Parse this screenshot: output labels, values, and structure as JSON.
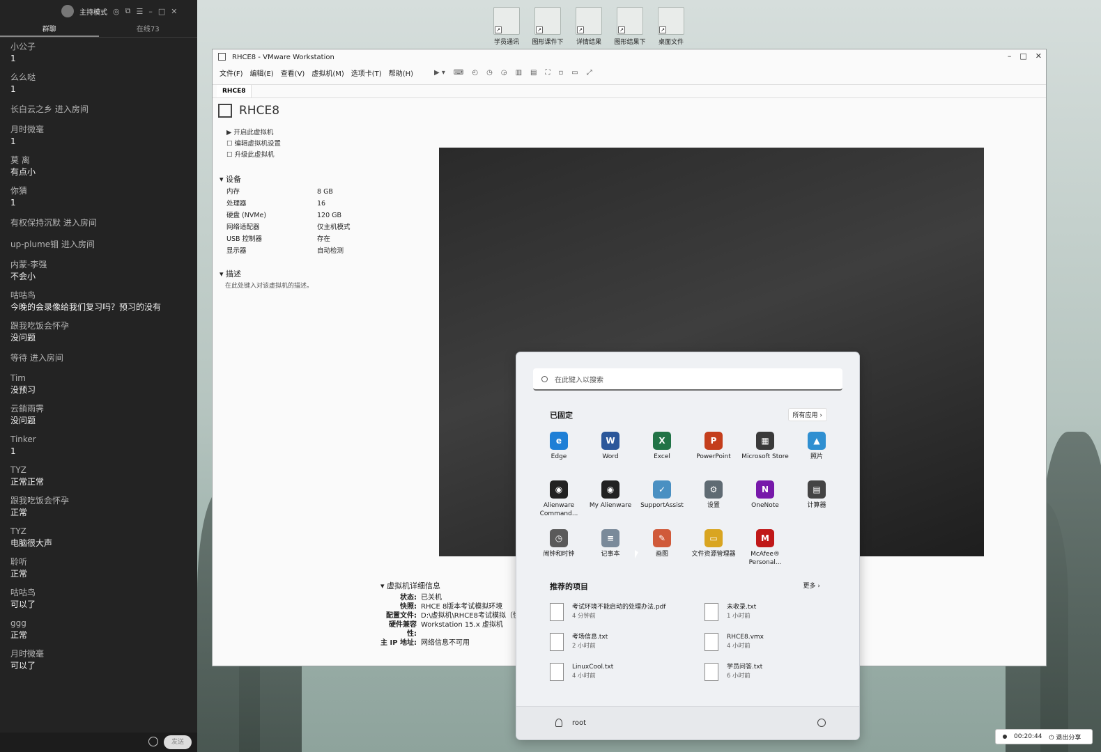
{
  "desktop": {
    "icons": [
      "学员通讯",
      "图形课件下",
      "详情结果",
      "图形结果下",
      "桌面文件"
    ]
  },
  "chat": {
    "header_title": "主持模式",
    "tabs": [
      "群聊",
      "在线73"
    ],
    "messages": [
      {
        "name": "小公子",
        "text": "1"
      },
      {
        "name": "么么哒",
        "text": "1"
      },
      {
        "join": "长白云之乡 进入房间"
      },
      {
        "name": "月时微毫",
        "text": "1"
      },
      {
        "name": "莫 离",
        "text": "有点小"
      },
      {
        "name": "你猜",
        "text": "1"
      },
      {
        "join": "有权保持沉默 进入房间"
      },
      {
        "join": "up-plume钼 进入房间"
      },
      {
        "name": "内蒙-李强",
        "text": "不会小"
      },
      {
        "name": "咕咕鸟",
        "text": "今晚的会录像给我们复习吗？预习的没有"
      },
      {
        "name": "跟我吃饭会怀孕",
        "text": "没问题"
      },
      {
        "join": "等待 进入房间"
      },
      {
        "name": "Tim",
        "text": "没预习"
      },
      {
        "name": "云銷雨霁",
        "text": "没问题"
      },
      {
        "name": "Tinker",
        "text": "1"
      },
      {
        "name": "TYZ",
        "text": "正常正常"
      },
      {
        "name": "跟我吃饭会怀孕",
        "text": "正常"
      },
      {
        "name": "TYZ",
        "text": "电脑很大声"
      },
      {
        "name": "聆听",
        "text": "正常"
      },
      {
        "name": "咕咕鸟",
        "text": "可以了"
      },
      {
        "name": "ggg",
        "text": "正常"
      },
      {
        "name": "月时微毫",
        "text": "可以了"
      }
    ],
    "send_label": "发送"
  },
  "vmware": {
    "title": "RHCE8 - VMware Workstation",
    "menu": [
      "文件(F)",
      "编辑(E)",
      "查看(V)",
      "虚拟机(M)",
      "选项卡(T)",
      "帮助(H)"
    ],
    "tab": "RHCE8",
    "vm_name": "RHCE8",
    "actions": [
      "开启此虚拟机",
      "编辑虚拟机设置",
      "升级此虚拟机"
    ],
    "devices_header": "设备",
    "devices": [
      {
        "name": "内存",
        "value": "8 GB"
      },
      {
        "name": "处理器",
        "value": "16"
      },
      {
        "name": "硬盘 (NVMe)",
        "value": "120 GB"
      },
      {
        "name": "网络适配器",
        "value": "仅主机模式"
      },
      {
        "name": "USB 控制器",
        "value": "存在"
      },
      {
        "name": "显示器",
        "value": "自动检测"
      }
    ],
    "desc_header": "描述",
    "desc_hint": "在此处键入对该虚拟机的描述。",
    "details_header": "虚拟机详细信息",
    "details": [
      {
        "k": "状态:",
        "v": "已关机"
      },
      {
        "k": "快照:",
        "v": "RHCE 8版本考试模拟环境"
      },
      {
        "k": "配置文件:",
        "v": "D:\\虚拟机\\RHCE8考试模拟（快"
      },
      {
        "k": "硬件兼容性:",
        "v": "Workstation 15.x 虚拟机"
      },
      {
        "k": "主 IP 地址:",
        "v": "网络信息不可用"
      }
    ]
  },
  "start_menu": {
    "search_placeholder": "在此键入以搜索",
    "pinned_header": "已固定",
    "all_apps": "所有应用 ›",
    "apps": [
      {
        "label": "Edge",
        "icon": "edge-icon",
        "color": "#1e7fd6",
        "glyph": "e"
      },
      {
        "label": "Word",
        "icon": "word-icon",
        "color": "#2b579a",
        "glyph": "W"
      },
      {
        "label": "Excel",
        "icon": "excel-icon",
        "color": "#217346",
        "glyph": "X"
      },
      {
        "label": "PowerPoint",
        "icon": "powerpoint-icon",
        "color": "#c43e1c",
        "glyph": "P"
      },
      {
        "label": "Microsoft Store",
        "icon": "store-icon",
        "color": "#3a3a3a",
        "glyph": "▦"
      },
      {
        "label": "照片",
        "icon": "photos-icon",
        "color": "#2f8fd1",
        "glyph": "▲"
      },
      {
        "label": "Alienware Command...",
        "icon": "alienware-icon",
        "color": "#222222",
        "glyph": "◉"
      },
      {
        "label": "My Alienware",
        "icon": "my-alienware-icon",
        "color": "#222222",
        "glyph": "◉"
      },
      {
        "label": "SupportAssist",
        "icon": "supportassist-icon",
        "color": "#4a90c2",
        "glyph": "✓"
      },
      {
        "label": "设置",
        "icon": "settings-icon",
        "color": "#5f6b73",
        "glyph": "⚙"
      },
      {
        "label": "OneNote",
        "icon": "onenote-icon",
        "color": "#7719aa",
        "glyph": "N"
      },
      {
        "label": "计算器",
        "icon": "calculator-icon",
        "color": "#444444",
        "glyph": "▤"
      },
      {
        "label": "闹钟和时钟",
        "icon": "clock-icon",
        "color": "#5a5a5a",
        "glyph": "◷"
      },
      {
        "label": "记事本",
        "icon": "notepad-icon",
        "color": "#7a8a9a",
        "glyph": "≡"
      },
      {
        "label": "画图",
        "icon": "paint-icon",
        "color": "#d05a3a",
        "glyph": "✎"
      },
      {
        "label": "文件资源管理器",
        "icon": "explorer-icon",
        "color": "#d9a521",
        "glyph": "▭"
      },
      {
        "label": "McAfee® Personal...",
        "icon": "mcafee-icon",
        "color": "#c01818",
        "glyph": "M"
      }
    ],
    "recommended_header": "推荐的项目",
    "more": "更多  ›",
    "recommended": [
      {
        "name": "考试环境不能启动的处理办法.pdf",
        "time": "4 分钟前"
      },
      {
        "name": "未收录.txt",
        "time": "1 小时前"
      },
      {
        "name": "考场信息.txt",
        "time": "2 小时前"
      },
      {
        "name": "RHCE8.vmx",
        "time": "4 小时前"
      },
      {
        "name": "LinuxCool.txt",
        "time": "4 小时前"
      },
      {
        "name": "学员问答.txt",
        "time": "6 小时前"
      }
    ],
    "user": "root"
  },
  "sharebar": {
    "time": "00:20:44",
    "exit_label": "退出分享"
  }
}
